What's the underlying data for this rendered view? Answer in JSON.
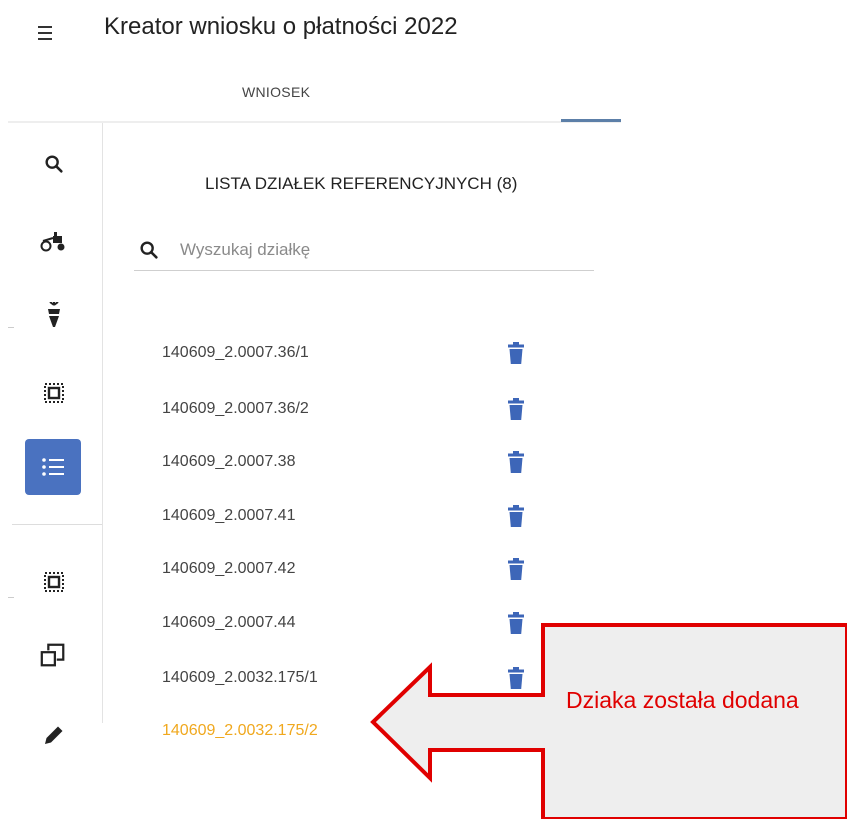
{
  "header": {
    "title": "Kreator wniosku o płatności 2022",
    "menu_icon": "hamburger-menu-icon"
  },
  "tabs": [
    {
      "label": "WNIOSEK"
    }
  ],
  "sidebar": {
    "accent": "#4a72c0",
    "items": [
      {
        "icon": "search-icon"
      },
      {
        "icon": "tractor-icon"
      },
      {
        "icon": "beet-icon"
      },
      {
        "icon": "select-area-icon"
      },
      {
        "icon": "list-icon",
        "active": true
      },
      {
        "icon": "select-area-icon"
      },
      {
        "icon": "copy-icon"
      },
      {
        "icon": "pencil-icon"
      }
    ]
  },
  "list": {
    "title": "LISTA DZIAŁEK REFERENCYJNYCH (8)",
    "search": {
      "placeholder": "Wyszukaj działkę",
      "value": ""
    },
    "items": [
      {
        "id": "140609_2.0007.36/1"
      },
      {
        "id": "140609_2.0007.36/2"
      },
      {
        "id": "140609_2.0007.38"
      },
      {
        "id": "140609_2.0007.41"
      },
      {
        "id": "140609_2.0007.42"
      },
      {
        "id": "140609_2.0007.44"
      },
      {
        "id": "140609_2.0032.175/1"
      },
      {
        "id": "140609_2.0032.175/2",
        "status": "added"
      }
    ],
    "added_color": "#f0a81e",
    "trash_color": "#3d66b8"
  },
  "callout": {
    "text": "Dziaka została dodana",
    "color": "#e00000"
  }
}
